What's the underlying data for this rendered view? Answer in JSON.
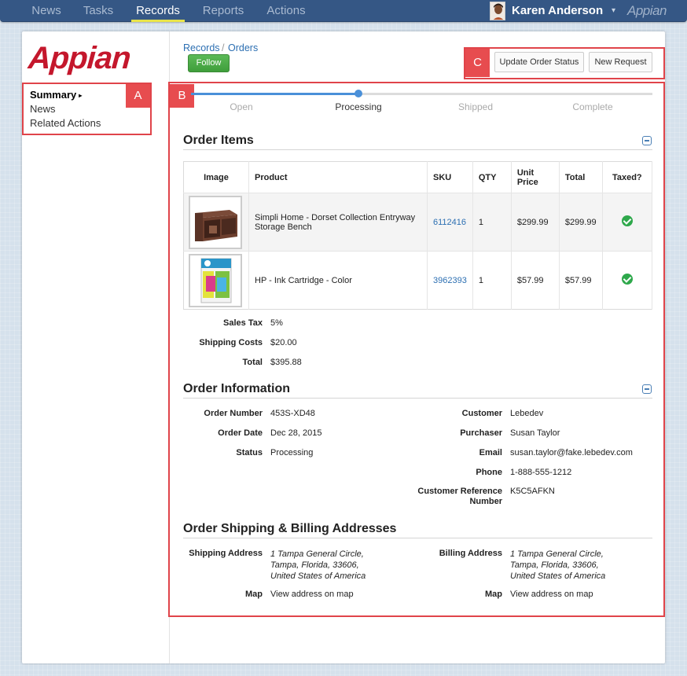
{
  "nav": {
    "tabs": [
      "News",
      "Tasks",
      "Records",
      "Reports",
      "Actions"
    ],
    "active_tab": "Records",
    "user_name": "Karen Anderson",
    "user_caret": "▾",
    "brand": "Appian"
  },
  "logo": "Appian",
  "sidebar": {
    "items": [
      "Summary",
      "News",
      "Related Actions"
    ],
    "active_marker": "▸"
  },
  "annotations": [
    "A",
    "B",
    "C"
  ],
  "breadcrumb": {
    "parent": "Records",
    "separator": "/",
    "current": "Orders"
  },
  "actions": {
    "follow": "Follow",
    "update_status": "Update Order Status",
    "new_request": "New Request"
  },
  "progress": {
    "steps": [
      "Open",
      "Processing",
      "Shipped",
      "Complete"
    ],
    "current": "Processing"
  },
  "order_items": {
    "title": "Order Items",
    "columns": [
      "Image",
      "Product",
      "SKU",
      "QTY",
      "Unit Price",
      "Total",
      "Taxed?"
    ],
    "rows": [
      {
        "product": "Simpli Home - Dorset Collection Entryway Storage Bench",
        "sku": "6112416",
        "qty": "1",
        "unit_price": "$299.99",
        "total": "$299.99",
        "taxed": true
      },
      {
        "product": "HP - Ink Cartridge - Color",
        "sku": "3962393",
        "qty": "1",
        "unit_price": "$57.99",
        "total": "$57.99",
        "taxed": true
      }
    ],
    "totals": [
      {
        "label": "Sales Tax",
        "value": "5%"
      },
      {
        "label": "Shipping Costs",
        "value": "$20.00"
      },
      {
        "label": "Total",
        "value": "$395.88"
      }
    ]
  },
  "order_info": {
    "title": "Order Information",
    "left": [
      {
        "label": "Order Number",
        "value": "453S-XD48"
      },
      {
        "label": "Order Date",
        "value": "Dec 28, 2015"
      },
      {
        "label": "Status",
        "value": "Processing"
      }
    ],
    "right": [
      {
        "label": "Customer",
        "value": "Lebedev"
      },
      {
        "label": "Purchaser",
        "value": "Susan Taylor"
      },
      {
        "label": "Email",
        "value": "susan.taylor@fake.lebedev.com"
      },
      {
        "label": "Phone",
        "value": "1-888-555-1212"
      },
      {
        "label": "Customer Reference Number",
        "value": "K5C5AFKN"
      }
    ]
  },
  "addresses": {
    "title": "Order Shipping & Billing Addresses",
    "shipping_label": "Shipping Address",
    "shipping_lines": [
      "1 Tampa General Circle,",
      "Tampa, Florida, 33606,",
      "United States of America"
    ],
    "billing_label": "Billing Address",
    "billing_lines": [
      "1 Tampa General Circle,",
      "Tampa, Florida, 33606,",
      "United States of America"
    ],
    "map_label": "Map",
    "map_link": "View address on map"
  },
  "colors": {
    "nav_bg": "#355785",
    "accent_yellow": "#e8e34a",
    "brand_red": "#c4172c",
    "link_blue": "#2c6fb2",
    "progress_blue": "#4a90d9",
    "annotation_red": "#e74c4f",
    "check_green": "#2ea84b",
    "follow_green": "#4aab45"
  }
}
